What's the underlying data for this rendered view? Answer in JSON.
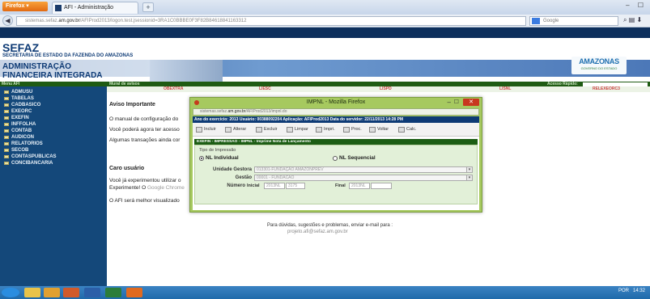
{
  "browser": {
    "button_label": "Firefox",
    "tab_title": "AFI - Administração Financeira",
    "new_tab": "+",
    "window_controls": "– ☐",
    "url_prefix": "sistemas.sefaz.",
    "url_domain": "am.gov.br",
    "url_path": "/AFIProd2013/logon.test.jsessionid=3RA1C0BBBE0F3F82B84618841163312",
    "search_placeholder": "Google",
    "nav_icons": "⌕ ▤ ⬇"
  },
  "header": {
    "org": "SEFAZ",
    "org_sub": "SECRETARIA DE ESTADO DA FAZENDA DO AMAZONAS",
    "system_line1": "ADMINISTRAÇÃO",
    "system_line2": "FINANCEIRA INTEGRADA",
    "logo_text": "AMAZONAS",
    "logo_sub": "GOVERNO DO ESTADO"
  },
  "greenbar": {
    "menu_label": "Menu AFI",
    "mural_label": "Mural de avisos",
    "quick_label": "Acesso Rápido:"
  },
  "menu": [
    "ADMUSU",
    "TABELAS",
    "CADBASICO",
    "EXEORC",
    "EXEFIN",
    "INFFOLHA",
    "CONTAB",
    "AUDICON",
    "RELATORIOS",
    "SECOB",
    "CONTASPUBLICAS",
    "CONCIBANCARIA"
  ],
  "tabs": [
    "OBEXTRA",
    "LIESC",
    "LISPD",
    "LISNL",
    "RELEXEORC3"
  ],
  "content": {
    "aviso_title": "Aviso Importante",
    "line1": "O manual de configuração do",
    "line2": "Você poderá agora ter acesso",
    "line3": "Algumas transações ainda cor",
    "caro": "Caro usuário",
    "line4": "Você já experimentou utilizar o",
    "line5a": "Experimente! O ",
    "line5b": "Google Chrome",
    "line6": "O AFI será melhor visualizado",
    "contact": "Para dúvidas, sugestões e problemas, enviar e-mail para :",
    "contact_mail": "projeto.afi@sefaz.am.gov.br"
  },
  "modal": {
    "title": "IMPNL - Mozilla Firefox",
    "url_prefix": "sistemas.sefaz.",
    "url_domain": "am.gov.br",
    "url_path": "/AFIProd2013/impnl.do",
    "info": "Ano do exercício: 2013     Usuário: 00388092204     Aplicação: AFIProd2013     Data do servidor: 22/11/2013 14:28 PM",
    "toolbar": [
      "Incluir",
      "Alterar",
      "Excluir",
      "Limpar",
      "Impri.",
      "Proc.",
      "Voltar",
      "Calc."
    ],
    "crumb": "EXEFIN - IMPRESSAO - IMPNL - Imprime Nota de Lançamento",
    "tipo_label": "Tipo de Impressão",
    "radio_individual": "NL Individual",
    "radio_sequencial": "NL Sequencial",
    "unidade_label": "Unidade Gestora",
    "unidade_value": "013301-FUNDAÇÃO AMAZONPREV",
    "gestao_label": "Gestão",
    "gestao_value": "00001 - FUNDACAO",
    "numero_label": "Número",
    "inicial_label": "Inicial",
    "inicial_prefix": "2013NL",
    "inicial_value": "3175",
    "final_label": "Final",
    "final_prefix": "2013NL",
    "final_value": ""
  },
  "taskbar": {
    "lang": "POR",
    "time": "14:32"
  }
}
